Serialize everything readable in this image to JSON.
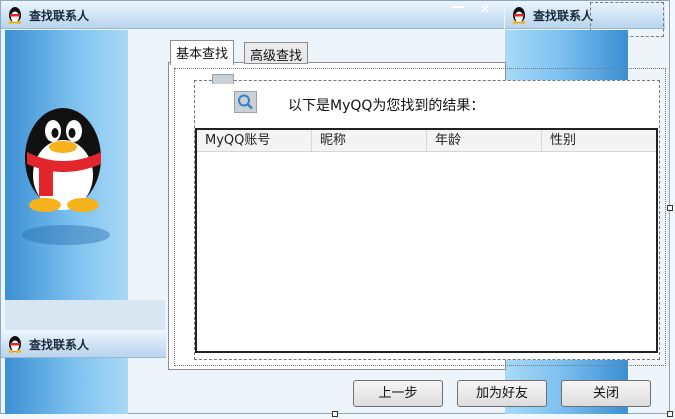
{
  "window": {
    "title": "查找联系人",
    "title_copy_right": "查找联系人",
    "title_copy_bottom": "查找联系人"
  },
  "tabs": [
    {
      "label": "基本查找",
      "active": true
    },
    {
      "label": "高级查找",
      "active": false
    }
  ],
  "search": {
    "result_text": "以下是MyQQ为您找到的结果："
  },
  "results_list": {
    "columns": [
      "MyQQ账号",
      "昵称",
      "年龄",
      "性别"
    ],
    "rows": []
  },
  "buttons": {
    "prev": "上一步",
    "add_friend": "加为好友",
    "close": "关闭"
  },
  "colors": {
    "accent_blue": "#3b8fd3",
    "penguin_scarf": "#e3262b"
  }
}
